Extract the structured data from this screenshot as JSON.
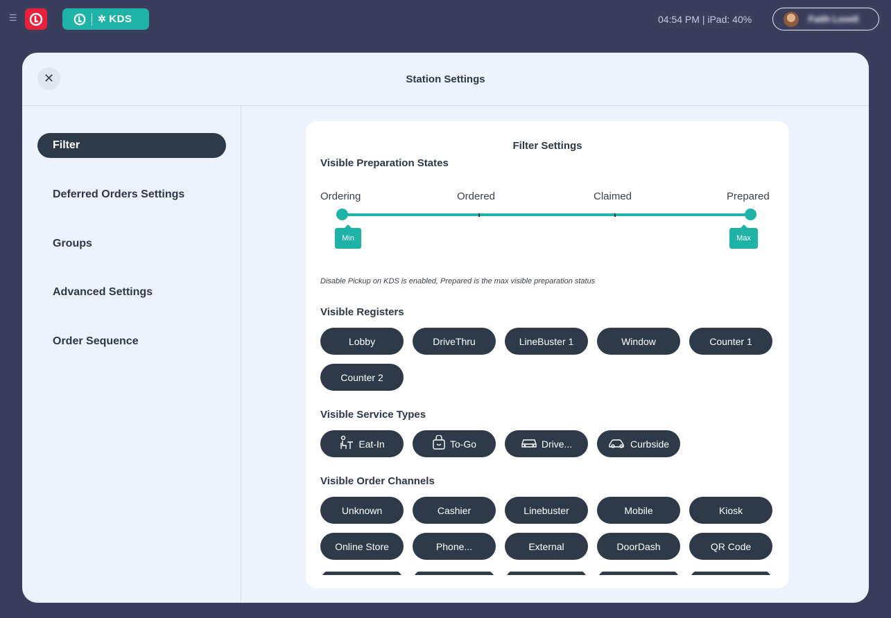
{
  "topbar": {
    "time": "04:54 PM",
    "device": "| iPad: 40%",
    "app_name": "KDS",
    "user_name": "Faith Lovell"
  },
  "modal": {
    "title": "Station Settings",
    "close_icon": "close-icon"
  },
  "sidebar": {
    "items": [
      {
        "label": "Filter",
        "active": true
      },
      {
        "label": "Deferred Orders Settings",
        "active": false
      },
      {
        "label": "Groups",
        "active": false
      },
      {
        "label": "Advanced Settings",
        "active": false
      },
      {
        "label": "Order Sequence",
        "active": false
      }
    ]
  },
  "filter": {
    "title": "Filter Settings",
    "prep_states": {
      "title": "Visible Preparation States",
      "states": [
        "Ordering",
        "Ordered",
        "Claimed",
        "Prepared"
      ],
      "min_label": "Min",
      "max_label": "Max",
      "min_index": 0,
      "max_index": 3,
      "note": "Disable Pickup on KDS is enabled, Prepared is the max visible preparation status"
    },
    "registers": {
      "title": "Visible Registers",
      "items": [
        "Lobby",
        "DriveThru",
        "LineBuster 1",
        "Window",
        "Counter 1",
        "Counter 2"
      ]
    },
    "service_types": {
      "title": "Visible Service Types",
      "items": [
        {
          "label": "Eat-In",
          "icon": "dine-in-icon"
        },
        {
          "label": "To-Go",
          "icon": "bag-icon"
        },
        {
          "label": "Drive...",
          "icon": "car-icon"
        },
        {
          "label": "Curbside",
          "icon": "curbside-car-icon"
        }
      ]
    },
    "order_channels": {
      "title": "Visible Order Channels",
      "items": [
        "Unknown",
        "Cashier",
        "Linebuster",
        "Mobile",
        "Kiosk",
        "Online Store",
        "Phone...",
        "External",
        "DoorDash",
        "QR Code"
      ]
    }
  },
  "colors": {
    "background": "#3a3d5c",
    "accent": "#1fb3a8",
    "brand_red": "#e8213b",
    "chip": "#2e3a4a",
    "modal_bg": "#edf3fd"
  }
}
